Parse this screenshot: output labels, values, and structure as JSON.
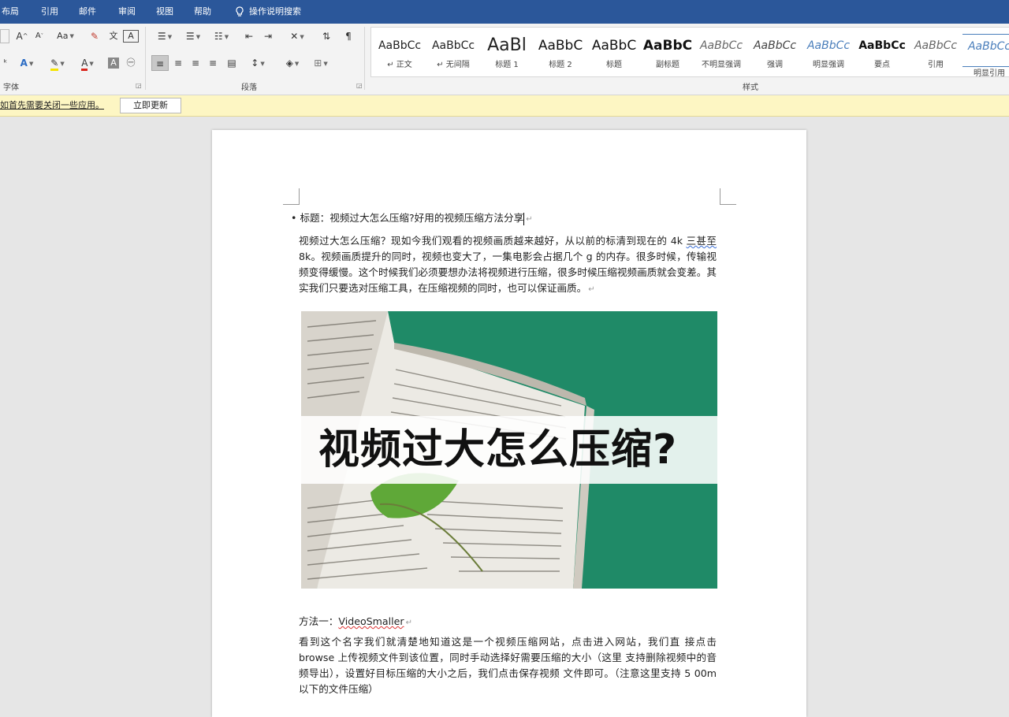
{
  "tabs": [
    "布局",
    "引用",
    "邮件",
    "审阅",
    "视图",
    "帮助"
  ],
  "tell_me": "操作说明搜索",
  "ribbon": {
    "font_group_label": "字体",
    "paragraph_group_label": "段落",
    "styles_group_label": "样式",
    "styles": [
      {
        "sample": "AaBbCc",
        "name": "↵ 正文"
      },
      {
        "sample": "AaBbCc",
        "name": "↵ 无间隔"
      },
      {
        "sample": "AaBl",
        "name": "标题 1"
      },
      {
        "sample": "AaBbC",
        "name": "标题 2"
      },
      {
        "sample": "AaBbC",
        "name": "标题"
      },
      {
        "sample": "AaBbC",
        "name": "副标题"
      },
      {
        "sample": "AaBbCc",
        "name": "不明显强调"
      },
      {
        "sample": "AaBbCc",
        "name": "强调"
      },
      {
        "sample": "AaBbCc",
        "name": "明显强调"
      },
      {
        "sample": "AaBbCc",
        "name": "要点"
      },
      {
        "sample": "AaBbCc",
        "name": "引用"
      },
      {
        "sample": "AaBbCc",
        "name": "明显引用"
      }
    ]
  },
  "message_bar": {
    "text": "如首先需要关闭一些应用。",
    "button": "立即更新"
  },
  "document": {
    "heading": "标题：视频过大怎么压缩?好用的视频压缩方法分享",
    "para1_before": "视频过大怎么压缩？现如今我们观看的视频画质越来越好，从以前的标清到现在的 4k ",
    "para1_flagged": "三甚至",
    "para1_after": " 8k。视频画质提升的同时，视频也变大了，一集电影会占据几个 g 的内存。很多时候，传输视频变得缓慢。这个时候我们必须要想办法将视频进行压缩，很多时候压缩视频画质就会变差。其实我们只要选对压缩工具，在压缩视频的同时，也可以保证画质。",
    "image_banner": "视频过大怎么压缩?",
    "method_label": "方法一：",
    "method_name": "VideoSmaller",
    "para2": "看到这个名字我们就清楚地知道这是一个视频压缩网站，点击进入网站，我们直 接点击 browse 上传视频文件到该位置，同时手动选择好需要压缩的大小（这里 支持删除视频中的音频导出），设置好目标压缩的大小之后，我们点击保存视频 文件即可。（注意这里支持 5 00m 以下的文件压缩）"
  },
  "colors": {
    "title_bar": "#2b579a",
    "image_background": "#1f8a67",
    "message_bar": "#fdf6c3"
  }
}
